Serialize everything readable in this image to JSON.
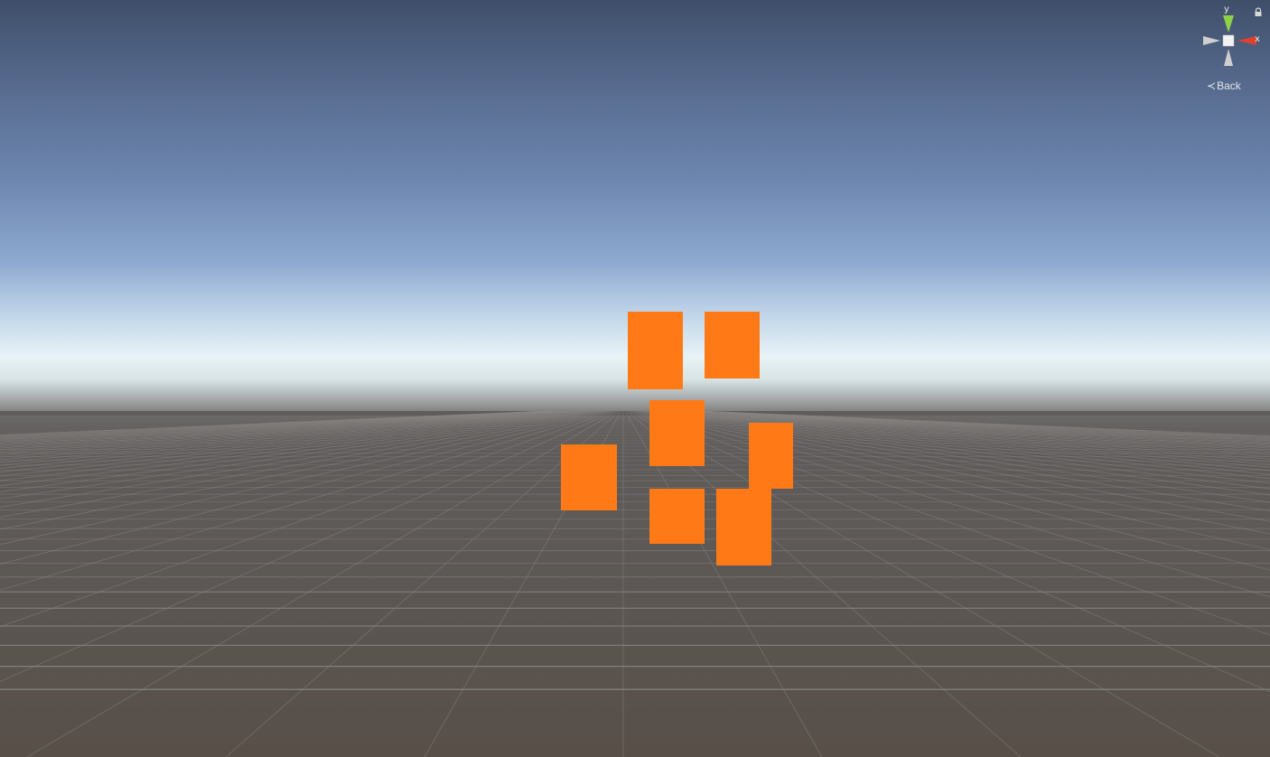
{
  "scene": {
    "sky_colors": [
      "#3f4f6a",
      "#6d87b0",
      "#e8f3f6"
    ],
    "ground_color": "#5e5a58",
    "grid_line_color": "#8a8785",
    "object_color": "#ff7a16",
    "object_count": 8
  },
  "gizmo": {
    "y_axis_label": "y",
    "x_axis_label": "x",
    "view_label": "Back",
    "y_axis_color": "#8fd24a",
    "x_axis_color": "#e0402f",
    "icons": [
      "lock-icon",
      "chevron-left-icon"
    ]
  }
}
